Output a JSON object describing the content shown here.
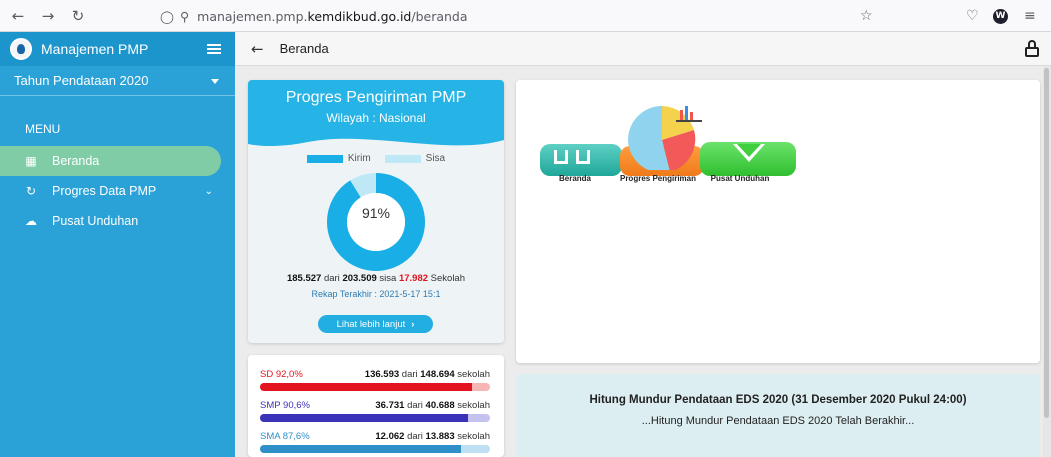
{
  "browser": {
    "url_prefix": "manajemen.pmp.",
    "url_host": "kemdikbud.go.id",
    "url_path": "/beranda",
    "avatar_letter": "W"
  },
  "sidebar": {
    "title": "Manajemen PMP",
    "year_select": "Tahun Pendataan 2020",
    "menu_label": "MENU",
    "items": [
      {
        "label": "Beranda",
        "icon": "dashboard-icon"
      },
      {
        "label": "Progres Data PMP",
        "icon": "sync-icon"
      },
      {
        "label": "Pusat Unduhan",
        "icon": "cloud-download-icon"
      }
    ],
    "accent": "#2aa2d8",
    "active_color": "#7fcca6"
  },
  "topbar": {
    "title": "Beranda"
  },
  "progress_card": {
    "title": "Progres Pengiriman PMP",
    "subtitle": "Wilayah : Nasional",
    "legend_sent": "Kirim",
    "legend_rest": "Sisa",
    "percent_label": "91%",
    "percent_value": 91,
    "sent": "185.527",
    "word_of": "dari",
    "total": "203.509",
    "word_rest": "sisa",
    "rest": "17.982",
    "unit": "Sekolah",
    "updated": "Rekap Terakhir : 2021-5-17 15:1",
    "button": "Lihat lebih lanjut"
  },
  "levels": [
    {
      "name": "SD 92,0%",
      "sent": "136.593",
      "word_of": "dari",
      "total": "148.694",
      "unit": "sekolah",
      "fraction": 0.92,
      "color": "#e3141f",
      "track": "#f6b6b6",
      "name_color": "#e3141f"
    },
    {
      "name": "SMP 90,6%",
      "sent": "36.731",
      "word_of": "dari",
      "total": "40.688",
      "unit": "sekolah",
      "fraction": 0.906,
      "color": "#3a32b8",
      "track": "#c5c2ef",
      "name_color": "#3a32b8"
    },
    {
      "name": "SMA 87,6%",
      "sent": "12.062",
      "word_of": "dari",
      "total": "13.883",
      "unit": "sekolah",
      "fraction": 0.876,
      "color": "#2f8fc9",
      "track": "#bfe0f2",
      "name_color": "#2f8fc9"
    }
  ],
  "shortcuts": [
    {
      "label": "Beranda"
    },
    {
      "label": "Progres Pengiriman"
    },
    {
      "label": "Pusat Unduhan"
    }
  ],
  "countdown": {
    "title": "Hitung Mundur Pendataan EDS 2020 (31 Desember 2020 Pukul 24:00)",
    "message": "...Hitung Mundur Pendataan EDS 2020 Telah Berakhir..."
  }
}
